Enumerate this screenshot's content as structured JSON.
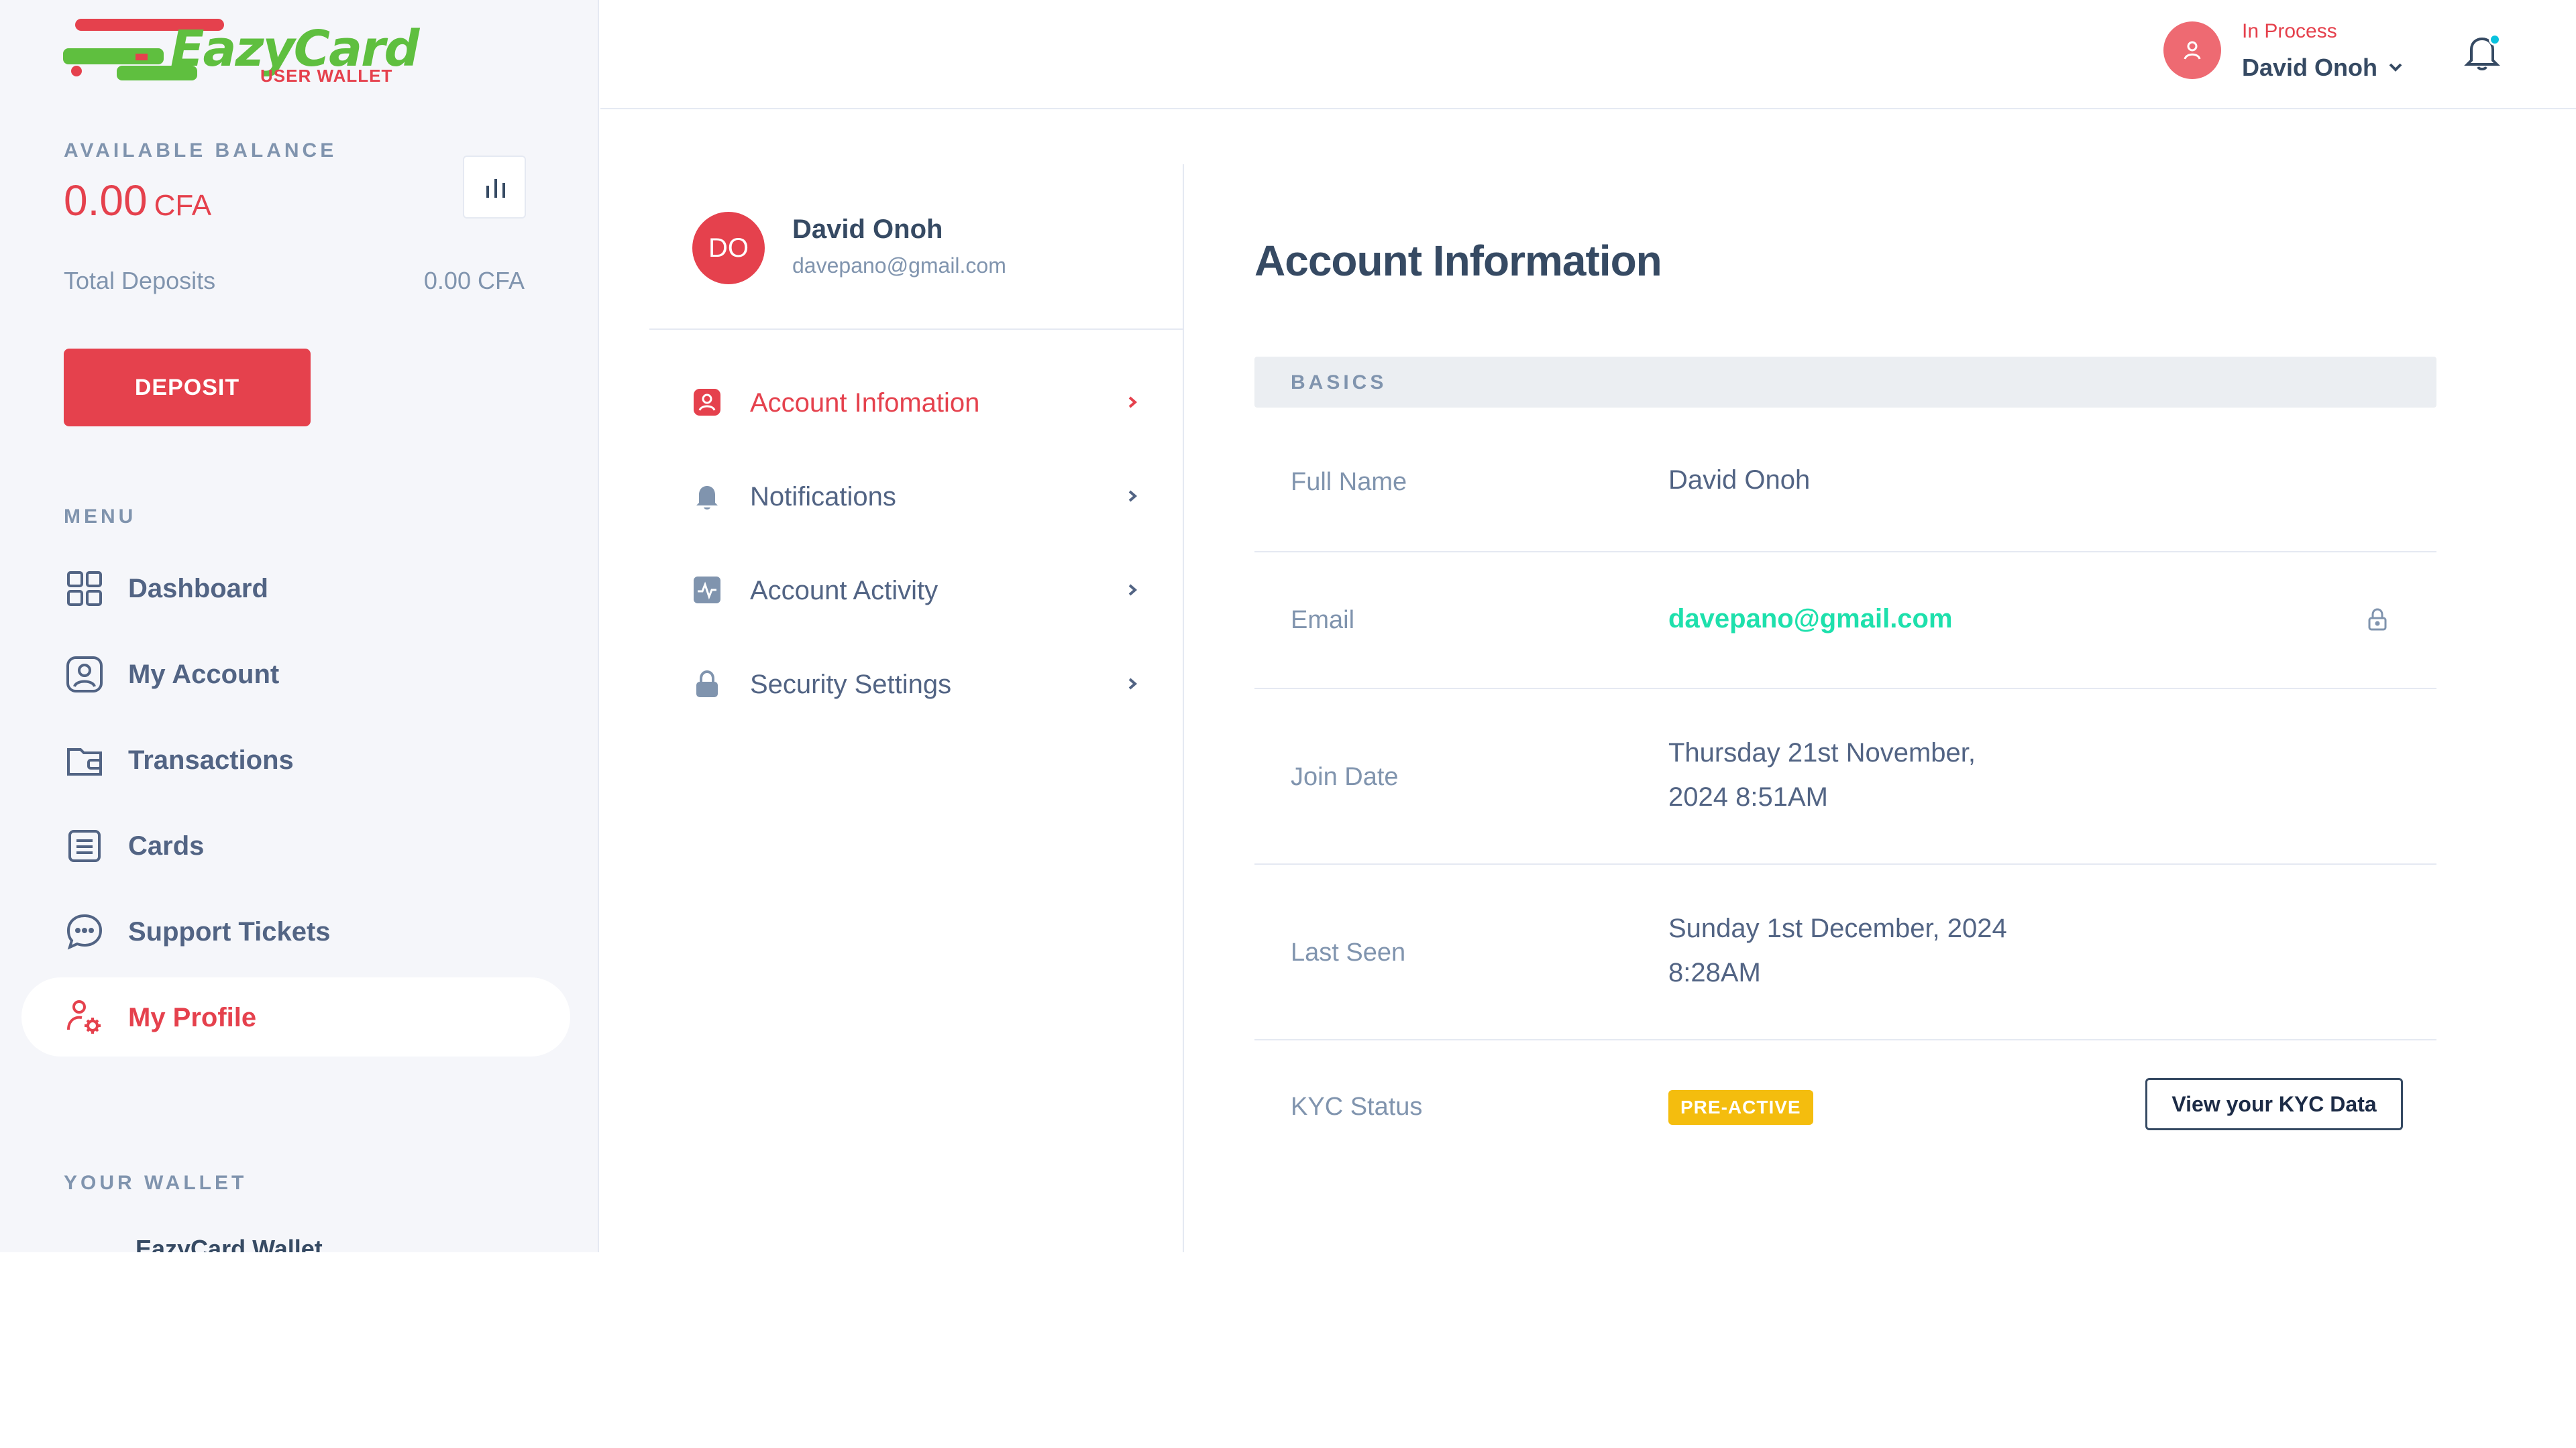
{
  "brand": {
    "name": "EazyCard",
    "subtitle": "USER WALLET"
  },
  "balance": {
    "title": "AVAILABLE BALANCE",
    "amount": "0.00",
    "currency": "CFA",
    "deposits_label": "Total Deposits",
    "deposits_value": "0.00 CFA",
    "deposit_button": "DEPOSIT"
  },
  "menu": {
    "title": "MENU",
    "items": [
      {
        "label": "Dashboard",
        "icon": "grid-icon"
      },
      {
        "label": "My Account",
        "icon": "user-square-icon"
      },
      {
        "label": "Transactions",
        "icon": "wallet-icon"
      },
      {
        "label": "Cards",
        "icon": "list-card-icon"
      },
      {
        "label": "Support Tickets",
        "icon": "chat-icon"
      },
      {
        "label": "My Profile",
        "icon": "user-settings-icon",
        "active": true
      }
    ]
  },
  "wallet": {
    "title": "YOUR WALLET",
    "name": "EazyCard Wallet"
  },
  "header": {
    "status": "In Process",
    "user_name": "David Onoh"
  },
  "profile": {
    "initials": "DO",
    "name": "David Onoh",
    "email": "davepano@gmail.com",
    "nav": [
      {
        "label": "Account Infomation",
        "icon": "user-badge-icon",
        "active": true
      },
      {
        "label": "Notifications",
        "icon": "bell-icon"
      },
      {
        "label": "Account Activity",
        "icon": "activity-icon"
      },
      {
        "label": "Security Settings",
        "icon": "lock-icon"
      }
    ]
  },
  "account": {
    "title": "Account Information",
    "section": "BASICS",
    "full_name_label": "Full Name",
    "full_name": "David Onoh",
    "email_label": "Email",
    "email": "davepano@gmail.com",
    "join_label": "Join Date",
    "join_line1": "Thursday 21st November,",
    "join_line2": "2024 8:51AM",
    "seen_label": "Last Seen",
    "seen_line1": "Sunday 1st December, 2024",
    "seen_line2": "8:28AM",
    "kyc_label": "KYC Status",
    "kyc_status": "PRE-ACTIVE",
    "kyc_button": "View your KYC Data"
  },
  "colors": {
    "accent": "#e5414d",
    "brand_green": "#5fbf3f",
    "email_green": "#1ee0ac",
    "badge_yellow": "#f4bd0e",
    "notification_dot": "#09c2de"
  }
}
